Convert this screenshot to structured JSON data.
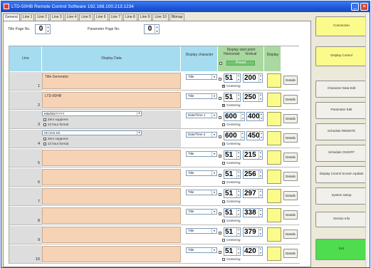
{
  "window": {
    "title": "LTD-50HB Remote Control Software 192.168.100.213:1234"
  },
  "tabs": [
    "General",
    "Line 1",
    "Line 2",
    "Line 3",
    "Line 4",
    "Line 5",
    "Line 6",
    "Line 7",
    "Line 8",
    "Line 9",
    "Line 10",
    "Bitmap"
  ],
  "page": {
    "title_page_label": "Title Page No.",
    "title_page_value": "0",
    "param_page_label": "Parameter Page No.",
    "param_page_value": "0"
  },
  "headers": {
    "line": "Line",
    "display_data": "Display Data",
    "display_character": "Display character",
    "display_start_point": "Display start point",
    "horizontal": "Horizontal",
    "vertical": "Vertical",
    "preset": "Preset",
    "display": "Display"
  },
  "rows": [
    {
      "num": "1",
      "kind": "text",
      "text": "Title Generator",
      "char": "Title",
      "h": "51",
      "v": "200",
      "centering_checked": true
    },
    {
      "num": "2",
      "kind": "text",
      "text": "LTD-50HB",
      "char": "Title",
      "h": "51",
      "v": "250",
      "centering_checked": true
    },
    {
      "num": "3",
      "kind": "date",
      "fmt": "MM/DD/YYYY",
      "zero": "Zero suppress",
      "twelve": "12 hour format",
      "char": "Date/Time 1",
      "h": "600",
      "v": "400",
      "centering_checked": false
    },
    {
      "num": "4",
      "kind": "date",
      "fmt": "HH:mm:SS",
      "zero": "Zero suppress",
      "twelve": "12 hour format",
      "char": "Date/Time 2",
      "h": "600",
      "v": "450",
      "centering_checked": false
    },
    {
      "num": "5",
      "kind": "text",
      "text": "",
      "char": "Title",
      "h": "51",
      "v": "215",
      "centering_checked": false
    },
    {
      "num": "6",
      "kind": "text",
      "text": "",
      "char": "Title",
      "h": "51",
      "v": "256",
      "centering_checked": false
    },
    {
      "num": "7",
      "kind": "text",
      "text": "",
      "char": "Title",
      "h": "51",
      "v": "297",
      "centering_checked": false
    },
    {
      "num": "8",
      "kind": "text",
      "text": "",
      "char": "Title",
      "h": "51",
      "v": "338",
      "centering_checked": false
    },
    {
      "num": "9",
      "kind": "text",
      "text": "",
      "char": "Title",
      "h": "51",
      "v": "379",
      "centering_checked": false
    },
    {
      "num": "10",
      "kind": "text",
      "text": "",
      "char": "Title",
      "h": "51",
      "v": "420",
      "centering_checked": false
    }
  ],
  "labels": {
    "centering": "Centering",
    "details": "Details"
  },
  "sidebar": [
    {
      "label": "Connection",
      "style": "yellow"
    },
    {
      "label": "Display Control",
      "style": "yellow"
    },
    {
      "label": "Character Data Edit",
      "style": "plain"
    },
    {
      "label": "Parameter Edit",
      "style": "plain"
    },
    {
      "label": "Schedule REMOTE",
      "style": "plain"
    },
    {
      "label": "Schedule ON/OFF",
      "style": "plain"
    },
    {
      "label": "Display Control Screen Update",
      "style": "plain"
    },
    {
      "label": "System Setup",
      "style": "plain"
    },
    {
      "label": "Version Info",
      "style": "plain"
    },
    {
      "label": "Exit",
      "style": "green"
    }
  ],
  "colors": {
    "titlebar": "#1d55d8",
    "header_blue": "#a6dcef",
    "header_green": "#a9d8a0",
    "text_cell": "#f7d3b6",
    "display_box": "#fbfb8c",
    "exit_button": "#4fdc4f"
  }
}
